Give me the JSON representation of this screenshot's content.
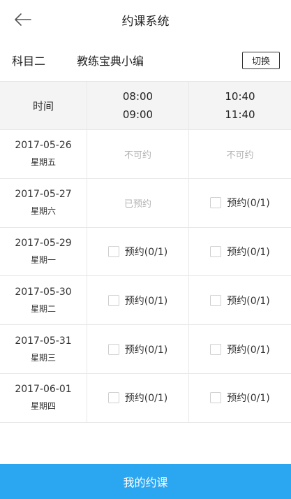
{
  "header": {
    "title": "约课系统",
    "back_icon": "arrow-left-icon"
  },
  "info": {
    "subject": "科目二",
    "coach": "教练宝典小编",
    "switch_label": "切换"
  },
  "table": {
    "time_header": "时间",
    "slots": [
      {
        "start": "08:00",
        "end": "09:00"
      },
      {
        "start": "10:40",
        "end": "11:40"
      }
    ],
    "rows": [
      {
        "date": "2017-05-26",
        "weekday": "星期五",
        "cells": [
          {
            "label": "不可约"
          },
          {
            "label": "不可约"
          }
        ]
      },
      {
        "date": "2017-05-27",
        "weekday": "星期六",
        "cells": [
          {
            "label": "已预约"
          },
          {
            "label": "预约(0/1)"
          }
        ]
      },
      {
        "date": "2017-05-29",
        "weekday": "星期一",
        "cells": [
          {
            "label": "预约(0/1)"
          },
          {
            "label": "预约(0/1)"
          }
        ]
      },
      {
        "date": "2017-05-30",
        "weekday": "星期二",
        "cells": [
          {
            "label": "预约(0/1)"
          },
          {
            "label": "预约(0/1)"
          }
        ]
      },
      {
        "date": "2017-05-31",
        "weekday": "星期三",
        "cells": [
          {
            "label": "预约(0/1)"
          },
          {
            "label": "预约(0/1)"
          }
        ]
      },
      {
        "date": "2017-06-01",
        "weekday": "星期四",
        "cells": [
          {
            "label": "预约(0/1)"
          },
          {
            "label": "预约(0/1)"
          }
        ]
      }
    ]
  },
  "footer": {
    "my_bookings_label": "我的约课"
  },
  "colors": {
    "accent": "#2ba6f0",
    "muted_text": "#b3b3b3",
    "header_bg": "#f4f4f4"
  }
}
